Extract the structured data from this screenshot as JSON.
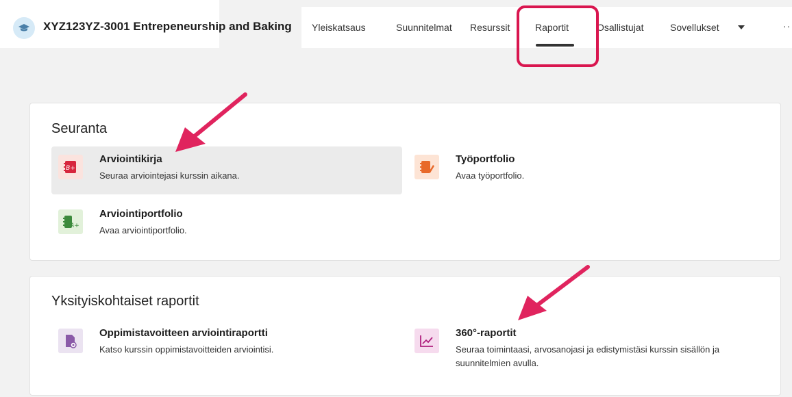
{
  "header": {
    "course_title": "XYZ123YZ-3001 Entrepeneurship and Baking",
    "tabs": [
      {
        "label": "Yleiskatsaus"
      },
      {
        "label": "Suunnitelmat"
      },
      {
        "label": "Resurssit"
      },
      {
        "label": "Raportit",
        "active": true
      },
      {
        "label": "Osallistujat"
      },
      {
        "label": "Sovellukset"
      }
    ],
    "more_label": "···"
  },
  "seuranta": {
    "title": "Seuranta",
    "items": [
      {
        "title": "Arviointikirja",
        "desc": "Seuraa arviointejasi kurssin aikana.",
        "icon": "gradebook-icon"
      },
      {
        "title": "Työportfolio",
        "desc": "Avaa työportfolio.",
        "icon": "work-portfolio-icon"
      },
      {
        "title": "Arviointiportfolio",
        "desc": "Avaa arviointiportfolio.",
        "icon": "assessment-portfolio-icon"
      }
    ]
  },
  "raportit": {
    "title": "Yksityiskohtaiset raportit",
    "items": [
      {
        "title": "Oppimistavoitteen arviointiraportti",
        "desc": "Katso kurssin oppimistavoitteiden arviointisi.",
        "icon": "objective-report-icon"
      },
      {
        "title": "360°-raportit",
        "desc": "Seuraa toimintaasi, arvosanojasi ja edistymistäsi kurssin sisällön ja suunnitelmien avulla.",
        "icon": "trend-chart-icon"
      }
    ]
  },
  "colors": {
    "highlight": "#d9164f",
    "gradebook_bg": "#fbe3de",
    "work_bg": "#fde4d5",
    "assessment_bg": "#e2f1da",
    "objective_bg": "#ebe3f1",
    "chart_bg": "#f6dbee"
  }
}
